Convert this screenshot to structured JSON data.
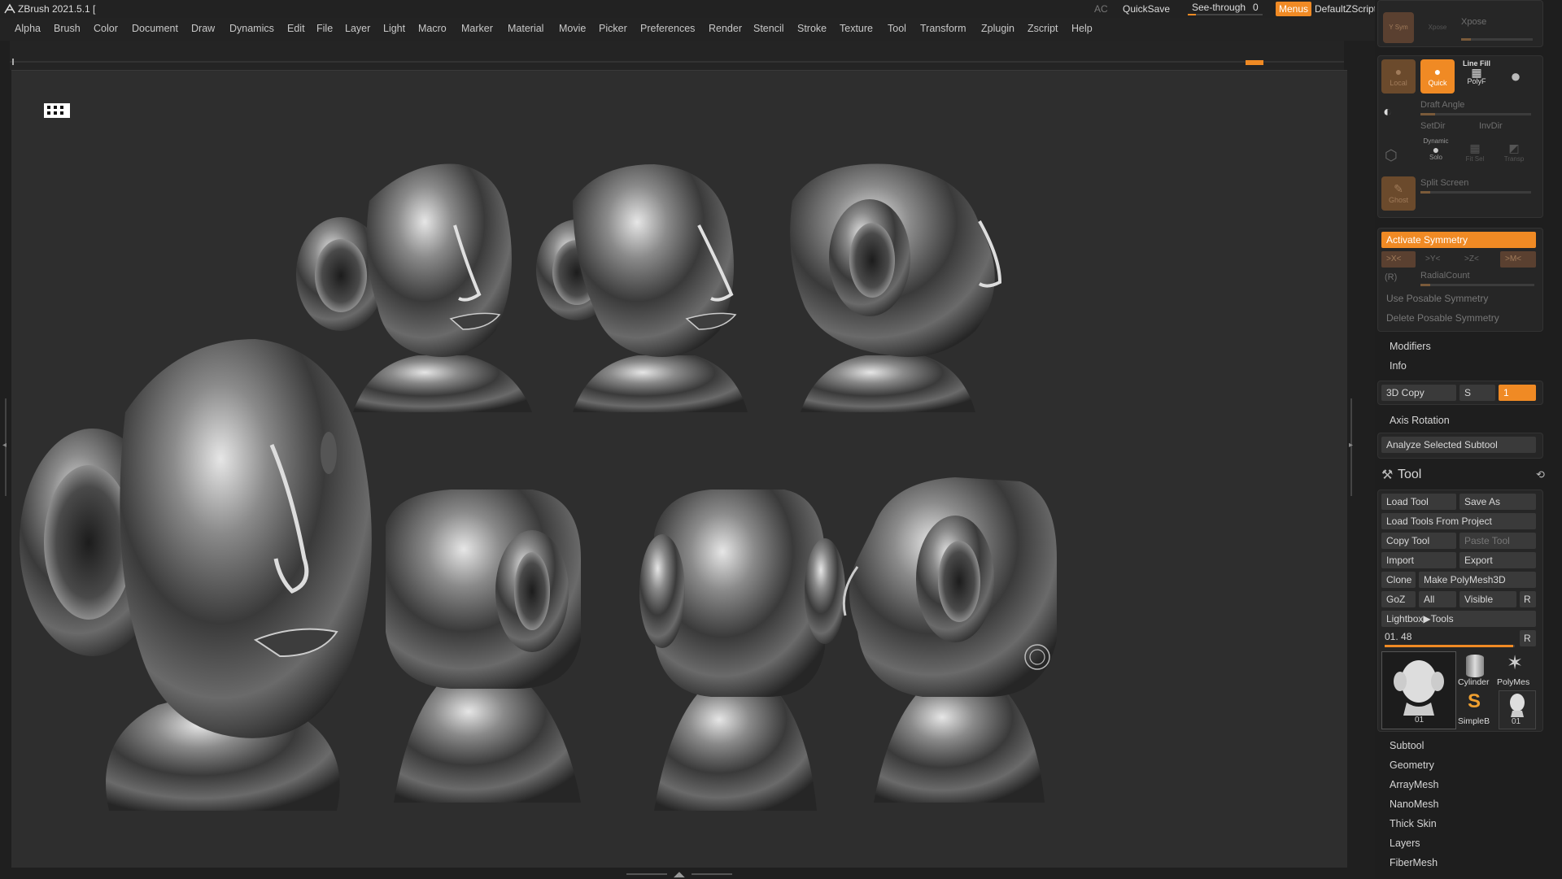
{
  "app": {
    "title": "ZBrush 2021.5.1 [",
    "ac": "AC",
    "quicksave": "QuickSave",
    "seethrough_label": "See-through",
    "seethrough_value": "0",
    "menus": "Menus",
    "zscript": "DefaultZScript",
    "accent": "#f08a24"
  },
  "menubar": [
    "Alpha",
    "Brush",
    "Color",
    "Document",
    "Draw",
    "Dynamics",
    "Edit",
    "File",
    "Layer",
    "Light",
    "Macro",
    "Marker",
    "Material",
    "Movie",
    "Picker",
    "Preferences",
    "Render",
    "Stencil",
    "Stroke",
    "Texture",
    "Tool",
    "Transform",
    "Zplugin",
    "Zscript",
    "Help"
  ],
  "panel": {
    "top_icons": {
      "ysym": "Y Sym",
      "xpose": "Xpose",
      "local": "Local",
      "quick": "Quick",
      "linefill": "Line Fill",
      "polyf": "PolyF"
    },
    "draft_angle": "Draft Angle",
    "setdir": "SetDir",
    "invdir": "InvDir",
    "dynamic": "Dynamic",
    "solo": "Solo",
    "fitsel": "Fit Sel",
    "transp": "Transp",
    "ghost": "Ghost",
    "split_screen": "Split Screen",
    "activate_symmetry": "Activate Symmetry",
    "axes": [
      ">X<",
      ">Y<",
      ">Z<",
      ">M<"
    ],
    "r": "(R)",
    "radialcount": "RadialCount",
    "use_posable": "Use Posable Symmetry",
    "delete_posable": "Delete Posable Symmetry",
    "modifiers": "Modifiers",
    "info": "Info",
    "copy3d": "3D Copy",
    "s": "S",
    "copy_value": "1",
    "axis_rotation": "Axis Rotation",
    "analyze": "Analyze Selected Subtool",
    "tool_title": "Tool",
    "load_tool": "Load Tool",
    "save_as": "Save As",
    "load_from_project": "Load Tools From Project",
    "copy_tool": "Copy Tool",
    "paste_tool": "Paste Tool",
    "import": "Import",
    "export": "Export",
    "clone": "Clone",
    "make_polymesh": "Make PolyMesh3D",
    "goz": "GoZ",
    "all": "All",
    "visible": "Visible",
    "r2": "R",
    "lightbox_tools": "Lightbox▶Tools",
    "tool_name": "01. 48",
    "r3": "R",
    "thumbs": {
      "main": "01",
      "cylinder": "Cylinder",
      "polymesh": "PolyMes",
      "simple": "SimpleB",
      "small": "01"
    },
    "sections": [
      "Subtool",
      "Geometry",
      "ArrayMesh",
      "NanoMesh",
      "Thick Skin",
      "Layers",
      "FiberMesh"
    ]
  }
}
